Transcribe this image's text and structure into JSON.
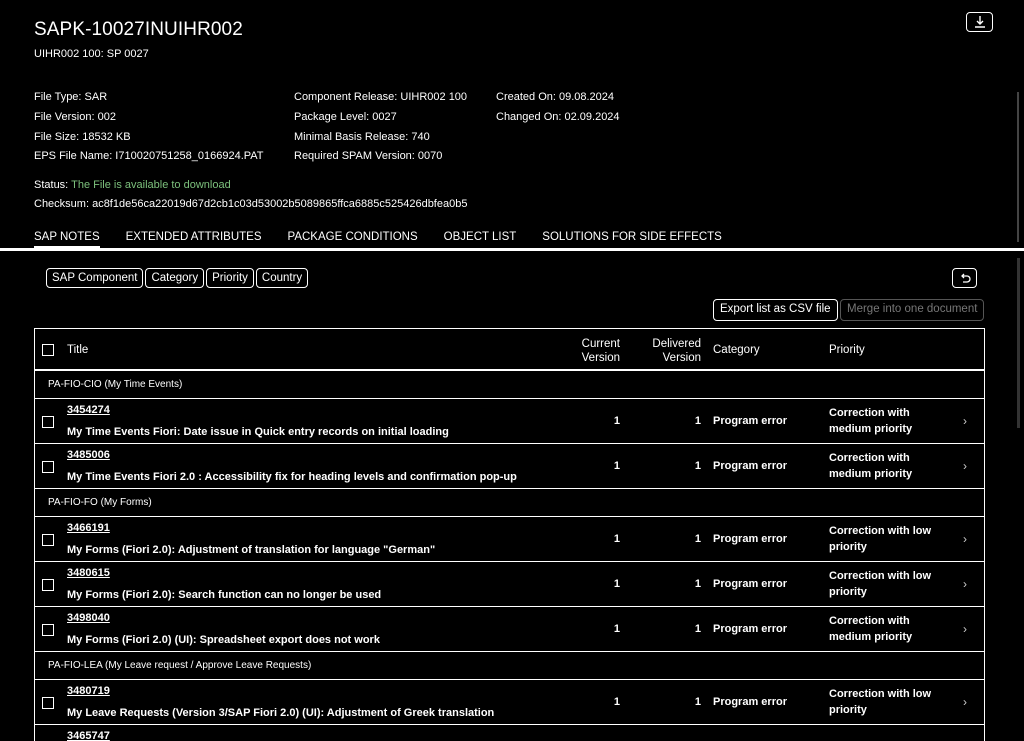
{
  "header": {
    "title": "SAPK-10027INUIHR002",
    "subtitle": "UIHR002 100: SP 0027",
    "col1": [
      "File Type: SAR",
      "File Version: 002",
      "File Size: 18532 KB",
      "EPS File Name: I710020751258_0166924.PAT"
    ],
    "col2": [
      "Component Release: UIHR002 100",
      "Package Level: 0027",
      "Minimal Basis Release: 740",
      "Required SPAM Version: 0070"
    ],
    "col3": [
      "Created On: 09.08.2024",
      "Changed On: 02.09.2024"
    ],
    "status_label": "Status: ",
    "status_value": "The File is available to download",
    "checksum": "Checksum: ac8f1de56ca22019d67d2cb1c03d53002b5089865ffca6885c525426dbfea0b5",
    "download_icon": "download-icon"
  },
  "tabs": [
    {
      "label": "SAP NOTES",
      "active": true
    },
    {
      "label": "EXTENDED ATTRIBUTES"
    },
    {
      "label": "PACKAGE CONDITIONS"
    },
    {
      "label": "OBJECT LIST"
    },
    {
      "label": "SOLUTIONS FOR SIDE EFFECTS"
    }
  ],
  "filters": [
    "SAP Component",
    "Category",
    "Priority",
    "Country"
  ],
  "actions": {
    "export": "Export list as CSV file",
    "merge": "Merge into one document",
    "reset_icon": "undo-icon"
  },
  "table": {
    "headers": {
      "title": "Title",
      "current": "Current Version",
      "delivered": "Delivered Version",
      "category": "Category",
      "priority": "Priority"
    },
    "groups": [
      {
        "name": "PA-FIO-CIO (My Time Events)",
        "rows": [
          {
            "num": "3454274",
            "title": "My Time Events Fiori: Date issue in Quick entry records on initial loading",
            "current": "1",
            "delivered": "1",
            "category": "Program error",
            "priority": "Correction with medium priority"
          },
          {
            "num": "3485006",
            "title": "My Time Events Fiori 2.0 : Accessibility fix for heading levels and confirmation pop-up",
            "current": "1",
            "delivered": "1",
            "category": "Program error",
            "priority": "Correction with medium priority"
          }
        ]
      },
      {
        "name": "PA-FIO-FO (My Forms)",
        "rows": [
          {
            "num": "3466191",
            "title": "My Forms (Fiori 2.0): Adjustment of translation for language \"German\"",
            "current": "1",
            "delivered": "1",
            "category": "Program error",
            "priority": "Correction with low priority"
          },
          {
            "num": "3480615",
            "title": "My Forms (Fiori 2.0): Search function can no longer be used",
            "current": "1",
            "delivered": "1",
            "category": "Program error",
            "priority": "Correction with low priority"
          },
          {
            "num": "3498040",
            "title": "My Forms (Fiori 2.0) (UI): Spreadsheet export does not work",
            "current": "1",
            "delivered": "1",
            "category": "Program error",
            "priority": "Correction with medium priority"
          }
        ]
      },
      {
        "name": "PA-FIO-LEA (My Leave request / Approve Leave Requests)",
        "rows": [
          {
            "num": "3480719",
            "title": "My Leave Requests (Version 3/SAP Fiori 2.0) (UI): Adjustment of Greek translation",
            "current": "1",
            "delivered": "1",
            "category": "Program error",
            "priority": "Correction with low priority"
          },
          {
            "num": "3465747",
            "title": "",
            "current": "",
            "delivered": "",
            "category": "",
            "priority": ""
          }
        ]
      }
    ]
  }
}
